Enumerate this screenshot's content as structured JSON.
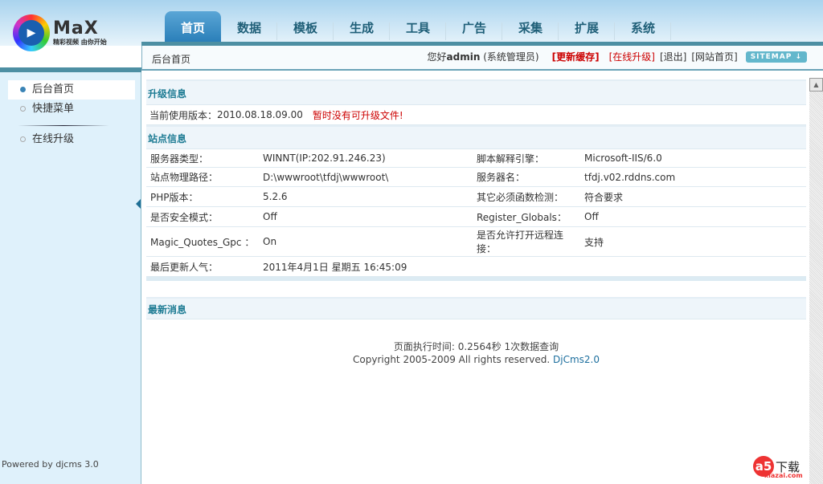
{
  "logo": {
    "text": "MaX",
    "slogan": "精彩视频 由你开始"
  },
  "nav": {
    "tabs": [
      "首页",
      "数据",
      "模板",
      "生成",
      "工具",
      "广告",
      "采集",
      "扩展",
      "系统"
    ],
    "active": 0
  },
  "breadcrumb": "后台首页",
  "userbar": {
    "greeting": "您好",
    "user": "admin",
    "role": "(系统管理员)",
    "refresh_cache": "[更新缓存]",
    "online_upgrade": "[在线升级]",
    "logout": "[退出]",
    "site_home": "[网站首页]",
    "sitemap": "SITEMAP ↓"
  },
  "sidebar": {
    "items": [
      "后台首页",
      "快捷菜单",
      "在线升级"
    ],
    "powered": "Powered by djcms 3.0"
  },
  "upgrade": {
    "title": "升级信息",
    "version_label": "当前使用版本：",
    "version": "2010.08.18.09.00",
    "notice": "暂时没有可升级文件!"
  },
  "site": {
    "title": "站点信息",
    "rows": [
      [
        "服务器类型：",
        "WINNT(IP:202.91.246.23)",
        "脚本解释引擎：",
        "Microsoft-IIS/6.0"
      ],
      [
        "站点物理路径：",
        "D:\\wwwroot\\tfdj\\wwwroot\\",
        "服务器名：",
        "tfdj.v02.rddns.com"
      ],
      [
        "PHP版本：",
        "5.2.6",
        "其它必须函数检测：",
        "符合要求"
      ],
      [
        "是否安全模式：",
        "Off",
        "Register_Globals：",
        "Off"
      ],
      [
        "Magic_Quotes_Gpc ：",
        "On",
        "是否允许打开远程连接：",
        "支持"
      ],
      [
        "最后更新人气：",
        "2011年4月1日 星期五 16:45:09",
        "",
        ""
      ]
    ]
  },
  "news": {
    "title": "最新消息"
  },
  "footer": {
    "exec": "页面执行时间: 0.2564秒 1次数据查询",
    "copyright": "Copyright 2005-2009 All rights reserved.",
    "link": "DjCms2.0"
  },
  "watermark": {
    "text": "下载",
    "site": "xiazai.com"
  }
}
